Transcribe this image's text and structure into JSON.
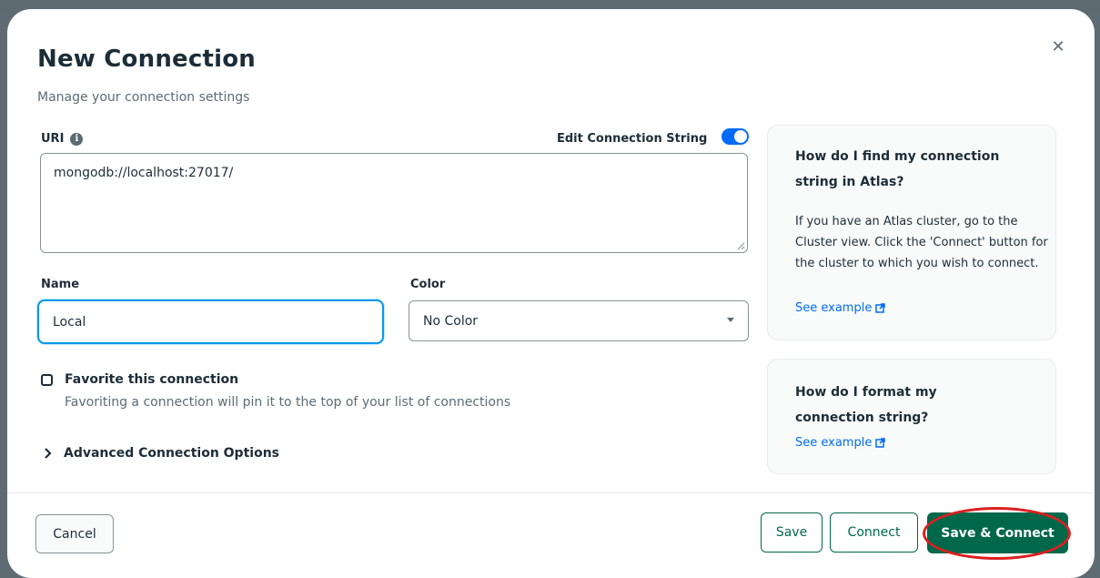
{
  "modal": {
    "title": "New Connection",
    "subtitle": "Manage your connection settings",
    "close_icon": "close-icon"
  },
  "uri": {
    "label": "URI",
    "info_icon": "info-icon",
    "toggle_label": "Edit Connection String",
    "toggle_on": true,
    "value": "mongodb://localhost:27017/"
  },
  "name": {
    "label": "Name",
    "value": "Local"
  },
  "color": {
    "label": "Color",
    "selected": "No Color"
  },
  "favorite": {
    "label": "Favorite this connection",
    "description": "Favoriting a connection will pin it to the top of your list of connections",
    "checked": false
  },
  "advanced": {
    "label": "Advanced Connection Options"
  },
  "help": [
    {
      "title": "How do I find my connection string in Atlas?",
      "body": "If you have an Atlas cluster, go to the Cluster view. Click the 'Connect' button for the cluster to which you wish to connect.",
      "link": "See example"
    },
    {
      "title": "How do I format my connection string?",
      "link": "See example"
    }
  ],
  "footer": {
    "cancel": "Cancel",
    "save": "Save",
    "connect": "Connect",
    "save_connect": "Save & Connect"
  },
  "colors": {
    "primary_green": "#00684a",
    "link_blue": "#016bf8",
    "focus_blue": "#0498ec",
    "annotation_red": "#dc1f1f"
  }
}
